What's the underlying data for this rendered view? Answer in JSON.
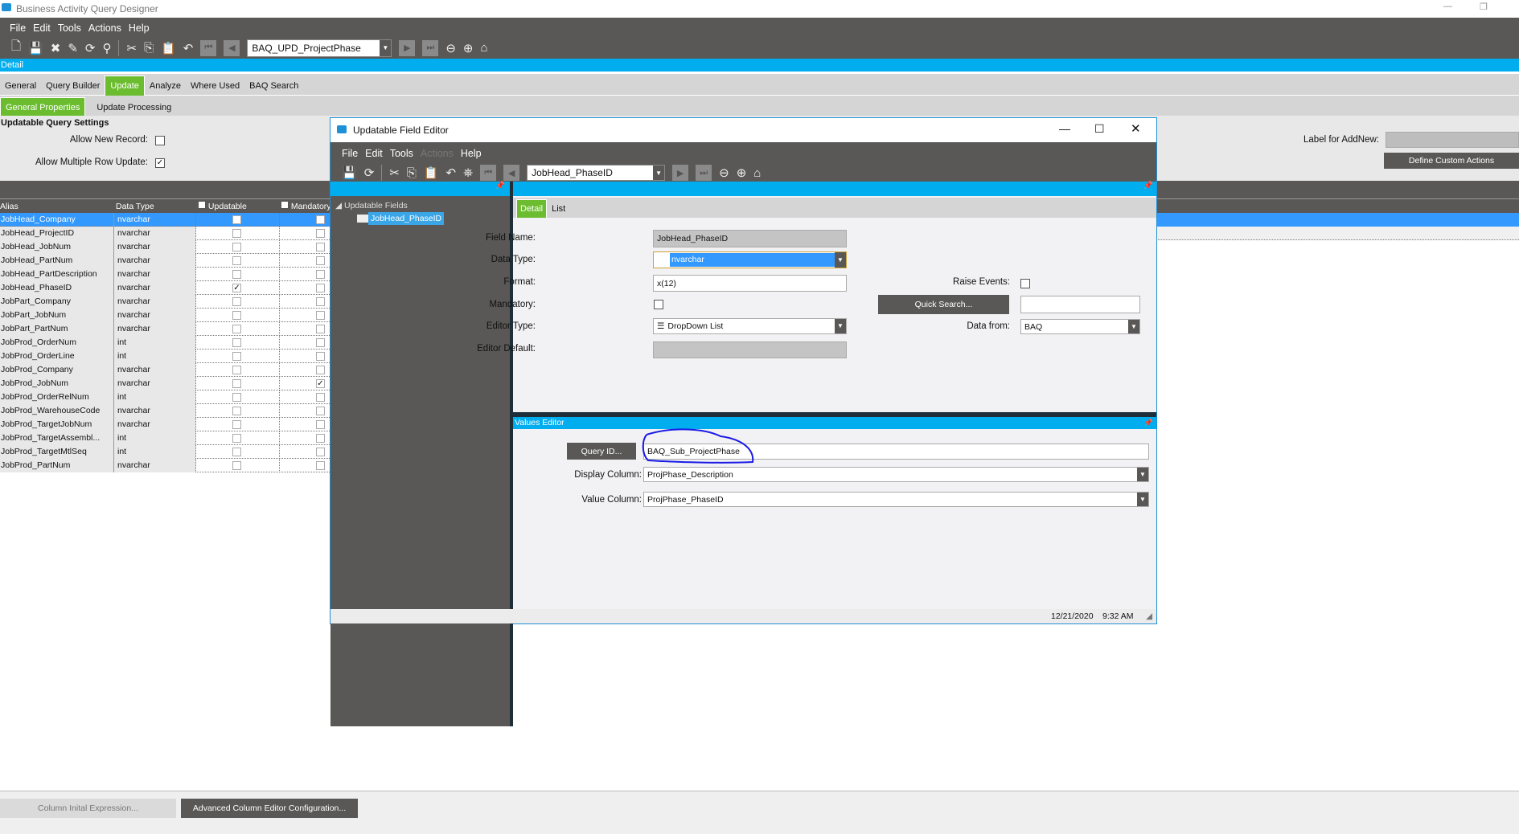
{
  "app": {
    "title": "Business Activity Query Designer",
    "menu": [
      "File",
      "Edit",
      "Tools",
      "Actions",
      "Help"
    ],
    "query_combo": "BAQ_UPD_ProjectPhase",
    "detail_label": "Detail",
    "tabs": [
      "General",
      "Query Builder",
      "Update",
      "Analyze",
      "Where Used",
      "BAQ Search"
    ],
    "subtabs": [
      "General Properties",
      "Update  Processing"
    ],
    "settings": {
      "heading": "Updatable Query Settings",
      "allow_new_record": "Allow New Record:",
      "allow_multiple": "Allow Multiple Row Update:",
      "label_addnew": "Label for AddNew:",
      "define_custom": "Define Custom Actions"
    },
    "grid": {
      "headers": [
        "Alias",
        "Data Type",
        "Updatable",
        "Mandatory"
      ],
      "rows": [
        {
          "alias": "JobHead_Company",
          "type": "nvarchar",
          "upd": false,
          "man": false
        },
        {
          "alias": "JobHead_ProjectID",
          "type": "nvarchar",
          "upd": false,
          "man": false
        },
        {
          "alias": "JobHead_JobNum",
          "type": "nvarchar",
          "upd": false,
          "man": false
        },
        {
          "alias": "JobHead_PartNum",
          "type": "nvarchar",
          "upd": false,
          "man": false
        },
        {
          "alias": "JobHead_PartDescription",
          "type": "nvarchar",
          "upd": false,
          "man": false
        },
        {
          "alias": "JobHead_PhaseID",
          "type": "nvarchar",
          "upd": true,
          "man": false
        },
        {
          "alias": "JobPart_Company",
          "type": "nvarchar",
          "upd": false,
          "man": false
        },
        {
          "alias": "JobPart_JobNum",
          "type": "nvarchar",
          "upd": false,
          "man": false
        },
        {
          "alias": "JobPart_PartNum",
          "type": "nvarchar",
          "upd": false,
          "man": false
        },
        {
          "alias": "JobProd_OrderNum",
          "type": "int",
          "upd": false,
          "man": false
        },
        {
          "alias": "JobProd_OrderLine",
          "type": "int",
          "upd": false,
          "man": false
        },
        {
          "alias": "JobProd_Company",
          "type": "nvarchar",
          "upd": false,
          "man": false
        },
        {
          "alias": "JobProd_JobNum",
          "type": "nvarchar",
          "upd": false,
          "man": true
        },
        {
          "alias": "JobProd_OrderRelNum",
          "type": "int",
          "upd": false,
          "man": false
        },
        {
          "alias": "JobProd_WarehouseCode",
          "type": "nvarchar",
          "upd": false,
          "man": false
        },
        {
          "alias": "JobProd_TargetJobNum",
          "type": "nvarchar",
          "upd": false,
          "man": false
        },
        {
          "alias": "JobProd_TargetAssembl...",
          "type": "int",
          "upd": false,
          "man": false
        },
        {
          "alias": "JobProd_TargetMtlSeq",
          "type": "int",
          "upd": false,
          "man": false
        },
        {
          "alias": "JobProd_PartNum",
          "type": "nvarchar",
          "upd": false,
          "man": false
        }
      ]
    },
    "bottom": {
      "column_initial": "Column Inital Expression...",
      "advanced": "Advanced Column Editor Configuration..."
    }
  },
  "dialog": {
    "title": "Updatable Field Editor",
    "menu": [
      "File",
      "Edit",
      "Tools",
      "Actions",
      "Help"
    ],
    "field_combo": "JobHead_PhaseID",
    "tree_root": "Updatable Fields",
    "tree_item": "JobHead_PhaseID",
    "tabs": [
      "Detail",
      "List"
    ],
    "form": {
      "field_name_label": "Field Name:",
      "field_name": "JobHead_PhaseID",
      "data_type_label": "Data Type:",
      "data_type": "nvarchar",
      "format_label": "Format:",
      "format": "x(12)",
      "mandatory_label": "Mandatory:",
      "editor_type_label": "Editor Type:",
      "editor_type": "DropDown List",
      "editor_default_label": "Editor Default:",
      "raise_events_label": "Raise Events:",
      "quick_search": "Quick Search...",
      "data_from_label": "Data from:",
      "data_from": "BAQ"
    },
    "values_editor": {
      "title": "Values Editor",
      "query_id_button": "Query ID...",
      "query_id": "BAQ_Sub_ProjectPhase",
      "display_column_label": "Display Column:",
      "display_column": "ProjPhase_Description",
      "value_column_label": "Value Column:",
      "value_column": "ProjPhase_PhaseID"
    },
    "status": {
      "date": "12/21/2020",
      "time": "9:32 AM"
    }
  },
  "colors": {
    "dark": "#595856",
    "accent_blue": "#00adef",
    "select_blue": "#3399ff",
    "green": "#6bbd2f",
    "annotation": "#1a1ae6"
  }
}
